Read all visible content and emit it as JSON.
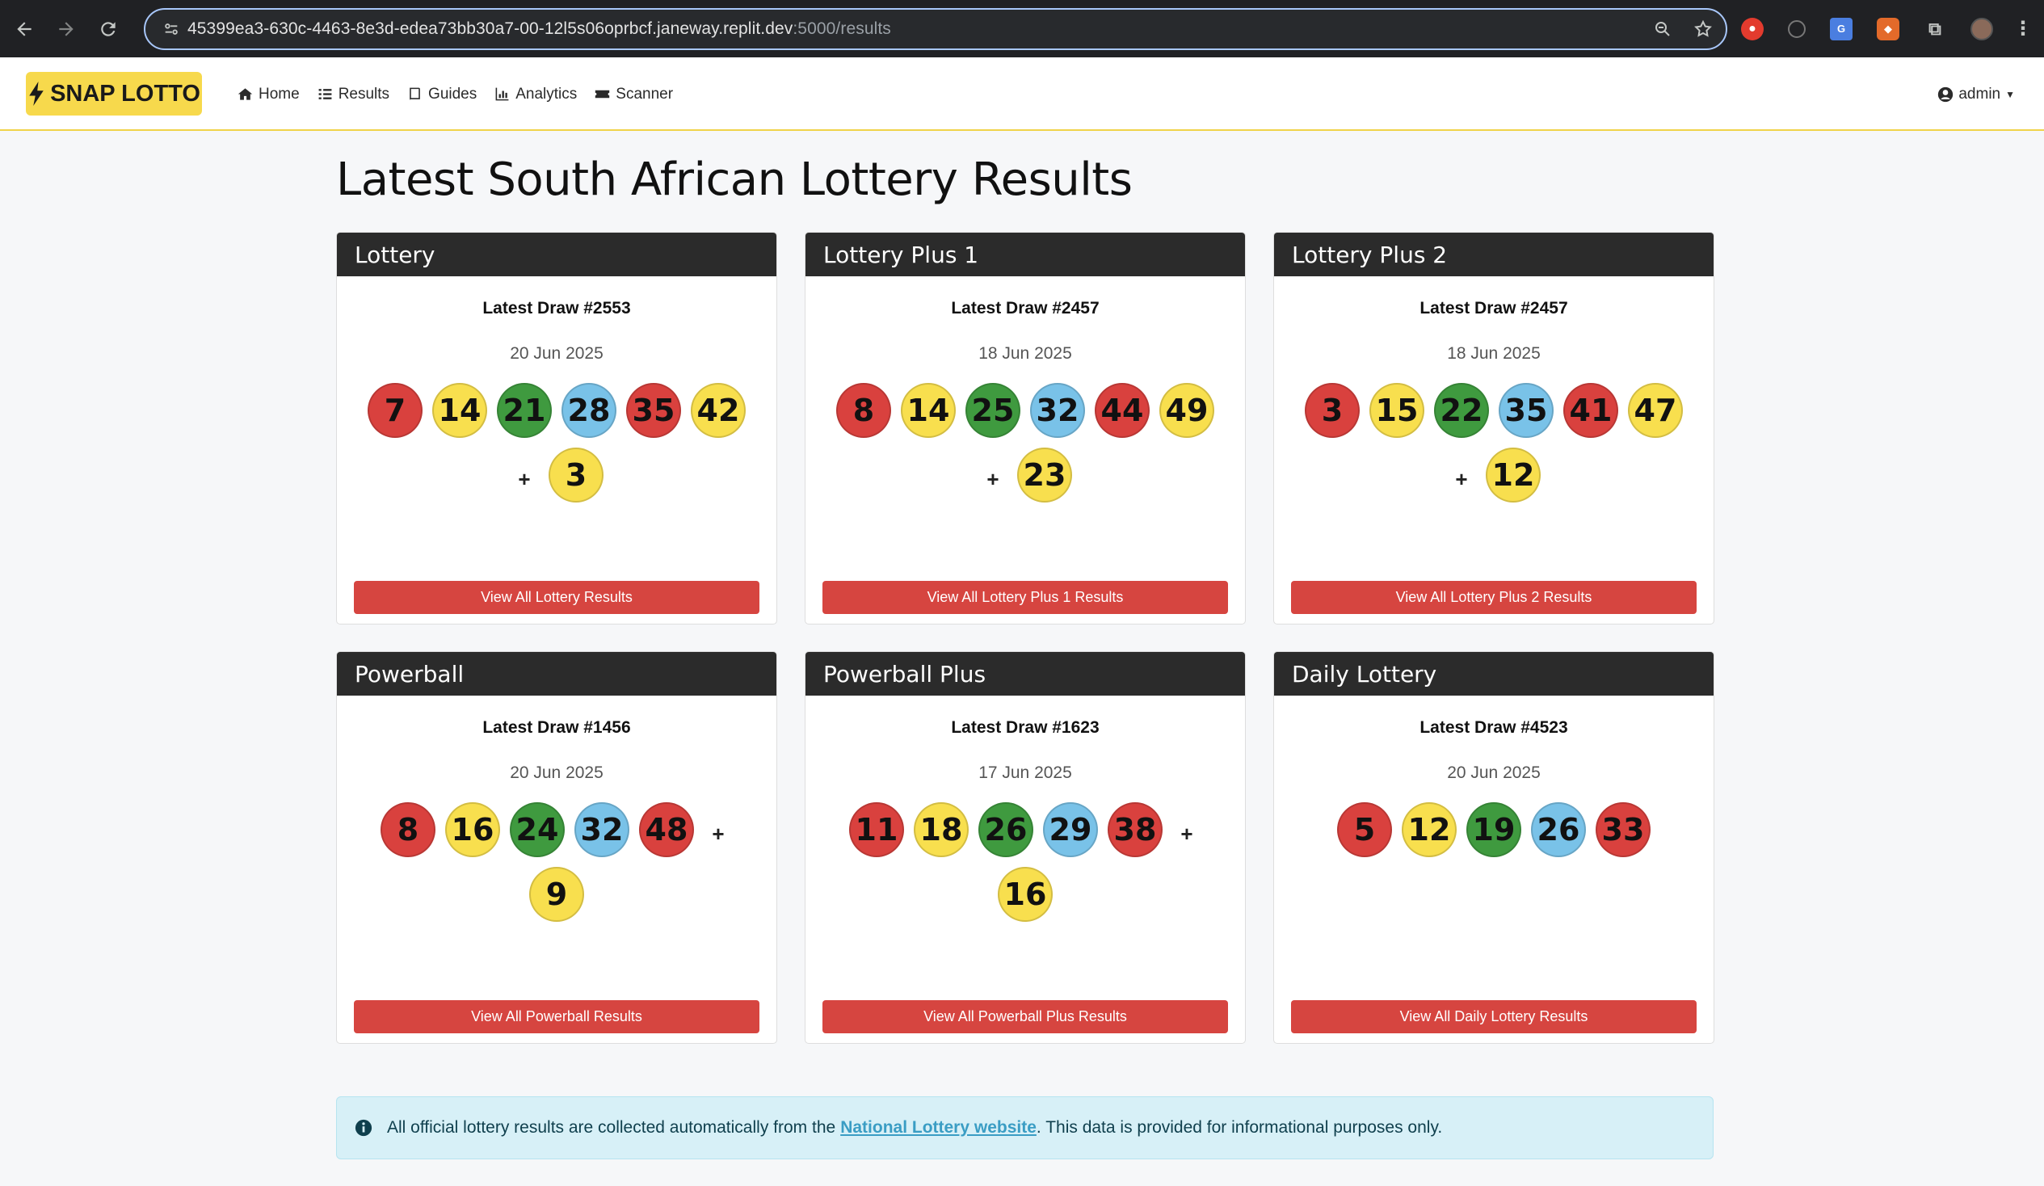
{
  "browser": {
    "url_main": "45399ea3-630c-4463-8e3d-edea73bb30a7-00-12l5s06oprbcf.janeway.replit.dev",
    "url_dim": ":5000/results"
  },
  "nav": {
    "brand": "SNAP LOTTO",
    "links": [
      "Home",
      "Results",
      "Guides",
      "Analytics",
      "Scanner"
    ],
    "user": "admin"
  },
  "page_title": "Latest South African Lottery Results",
  "cards": [
    {
      "name": "Lottery",
      "draw": "Latest Draw #2553",
      "date": "20 Jun 2025",
      "balls": [
        7,
        14,
        21,
        28,
        35,
        42
      ],
      "bonus": 3,
      "button": "View All Lottery Results"
    },
    {
      "name": "Lottery Plus 1",
      "draw": "Latest Draw #2457",
      "date": "18 Jun 2025",
      "balls": [
        8,
        14,
        25,
        32,
        44,
        49
      ],
      "bonus": 23,
      "button": "View All Lottery Plus 1 Results"
    },
    {
      "name": "Lottery Plus 2",
      "draw": "Latest Draw #2457",
      "date": "18 Jun 2025",
      "balls": [
        3,
        15,
        22,
        35,
        41,
        47
      ],
      "bonus": 12,
      "button": "View All Lottery Plus 2 Results"
    },
    {
      "name": "Powerball",
      "draw": "Latest Draw #1456",
      "date": "20 Jun 2025",
      "balls": [
        8,
        16,
        24,
        32,
        48
      ],
      "bonus": 9,
      "button": "View All Powerball Results"
    },
    {
      "name": "Powerball Plus",
      "draw": "Latest Draw #1623",
      "date": "17 Jun 2025",
      "balls": [
        11,
        18,
        26,
        29,
        38
      ],
      "bonus": 16,
      "button": "View All Powerball Plus Results"
    },
    {
      "name": "Daily Lottery",
      "draw": "Latest Draw #4523",
      "date": "20 Jun 2025",
      "balls": [
        5,
        12,
        19,
        26,
        33
      ],
      "bonus": null,
      "button": "View All Daily Lottery Results"
    }
  ],
  "ball_colors": [
    "red",
    "yellow",
    "green",
    "blue"
  ],
  "colors": {
    "red": "#d9413e",
    "yellow": "#f8df4e",
    "green": "#3f9a3f",
    "blue": "#79c2e8",
    "button": "#d64540",
    "brand": "#f7d94c"
  },
  "info": {
    "prefix": "All official lottery results are collected automatically from the",
    "link": "National Lottery website",
    "suffix": ". This data is provided for informational purposes only."
  }
}
